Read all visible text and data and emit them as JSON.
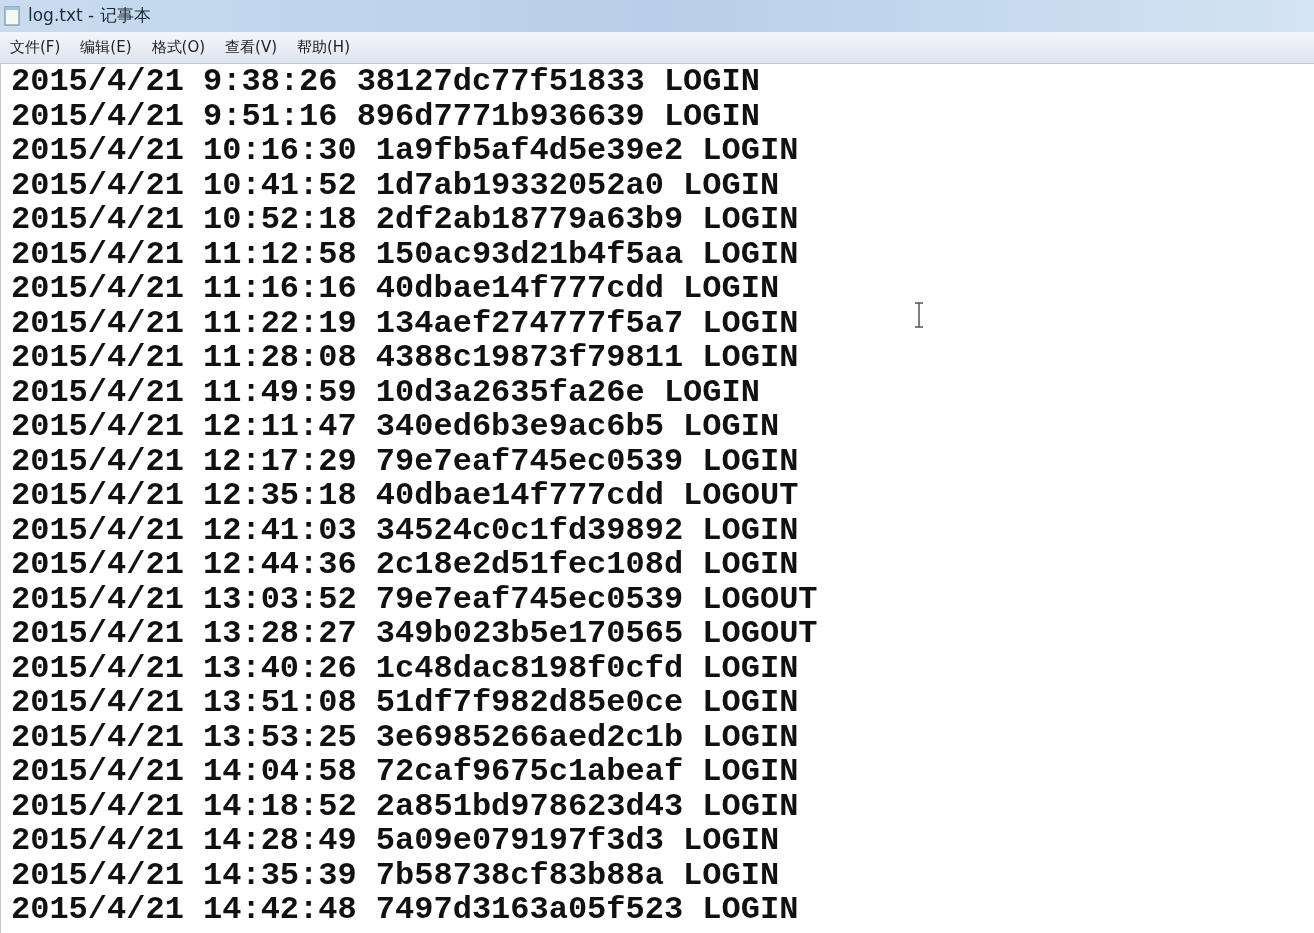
{
  "window": {
    "title": "log.txt - 记事本"
  },
  "menu": [
    "文件(F)",
    "编辑(E)",
    "格式(O)",
    "查看(V)",
    "帮助(H)"
  ],
  "lines": [
    "2015/4/21 9:38:26 38127dc77f51833 LOGIN",
    "2015/4/21 9:51:16 896d7771b936639 LOGIN",
    "2015/4/21 10:16:30 1a9fb5af4d5e39e2 LOGIN",
    "2015/4/21 10:41:52 1d7ab19332052a0 LOGIN",
    "2015/4/21 10:52:18 2df2ab18779a63b9 LOGIN",
    "2015/4/21 11:12:58 150ac93d21b4f5aa LOGIN",
    "2015/4/21 11:16:16 40dbae14f777cdd LOGIN",
    "2015/4/21 11:22:19 134aef274777f5a7 LOGIN",
    "2015/4/21 11:28:08 4388c19873f79811 LOGIN",
    "2015/4/21 11:49:59 10d3a2635fa26e LOGIN",
    "2015/4/21 12:11:47 340ed6b3e9ac6b5 LOGIN",
    "2015/4/21 12:17:29 79e7eaf745ec0539 LOGIN",
    "2015/4/21 12:35:18 40dbae14f777cdd LOGOUT",
    "2015/4/21 12:41:03 34524c0c1fd39892 LOGIN",
    "2015/4/21 12:44:36 2c18e2d51fec108d LOGIN",
    "2015/4/21 13:03:52 79e7eaf745ec0539 LOGOUT",
    "2015/4/21 13:28:27 349b023b5e170565 LOGOUT",
    "2015/4/21 13:40:26 1c48dac8198f0cfd LOGIN",
    "2015/4/21 13:51:08 51df7f982d85e0ce LOGIN",
    "2015/4/21 13:53:25 3e6985266aed2c1b LOGIN",
    "2015/4/21 14:04:58 72caf9675c1abeaf LOGIN",
    "2015/4/21 14:18:52 2a851bd978623d43 LOGIN",
    "2015/4/21 14:28:49 5a09e079197f3d3 LOGIN",
    "2015/4/21 14:35:39 7b58738cf83b88a LOGIN",
    "2015/4/21 14:42:48 7497d3163a05f523 LOGIN"
  ]
}
